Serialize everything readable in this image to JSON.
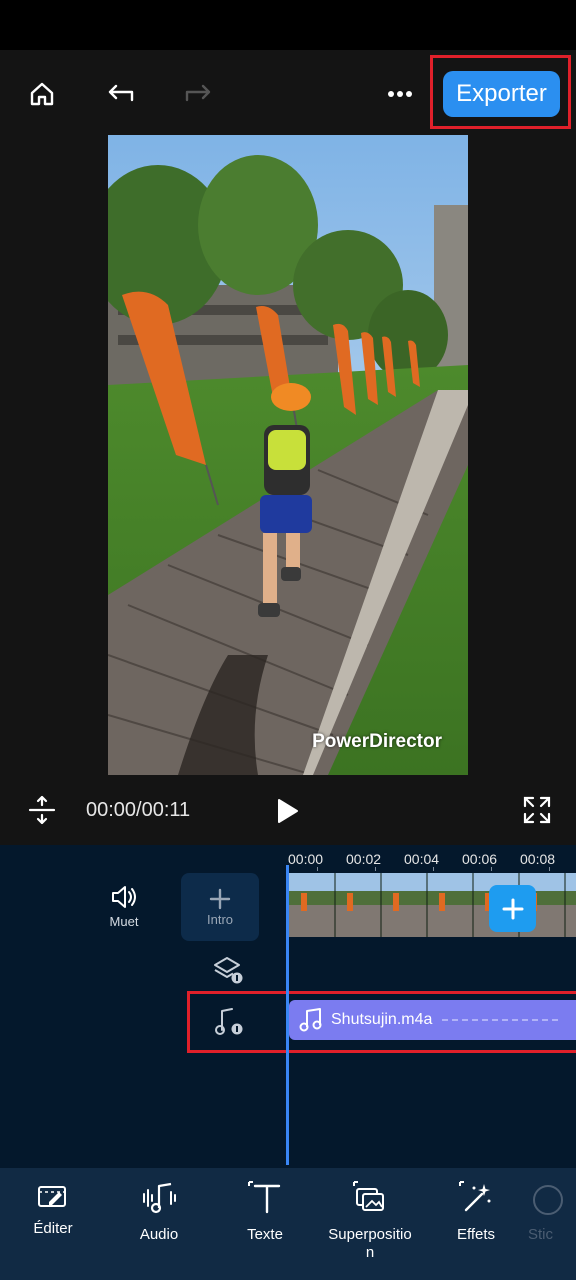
{
  "header": {
    "export_label": "Exporter",
    "icons": [
      "home-icon",
      "undo-icon",
      "redo-icon",
      "more-icon"
    ]
  },
  "preview": {
    "watermark": "PowerDirector"
  },
  "player": {
    "time_display": "00:00/00:11",
    "icons": [
      "split-icon",
      "play-icon",
      "fullscreen-icon"
    ]
  },
  "timeline": {
    "ruler": [
      "00:00",
      "00:02",
      "00:04",
      "00:06",
      "00:08"
    ],
    "mute_label": "Muet",
    "intro_label": "Intro",
    "audio_clip_name": "Shutsujin.m4a",
    "colors": {
      "playhead": "#3a86f5",
      "audio_clip": "#7b7cf0",
      "add_button": "#1e9cf0",
      "highlight": "#e0202a"
    }
  },
  "bottom_nav": {
    "items": [
      {
        "label": "Éditer",
        "icon": "edit-icon"
      },
      {
        "label": "Audio",
        "icon": "audio-icon"
      },
      {
        "label": "Texte",
        "icon": "text-icon"
      },
      {
        "label": "Superpositio\nn",
        "icon": "overlay-icon"
      },
      {
        "label": "Effets",
        "icon": "effects-icon"
      },
      {
        "label": "Stic",
        "icon": "sticker-icon"
      }
    ]
  }
}
